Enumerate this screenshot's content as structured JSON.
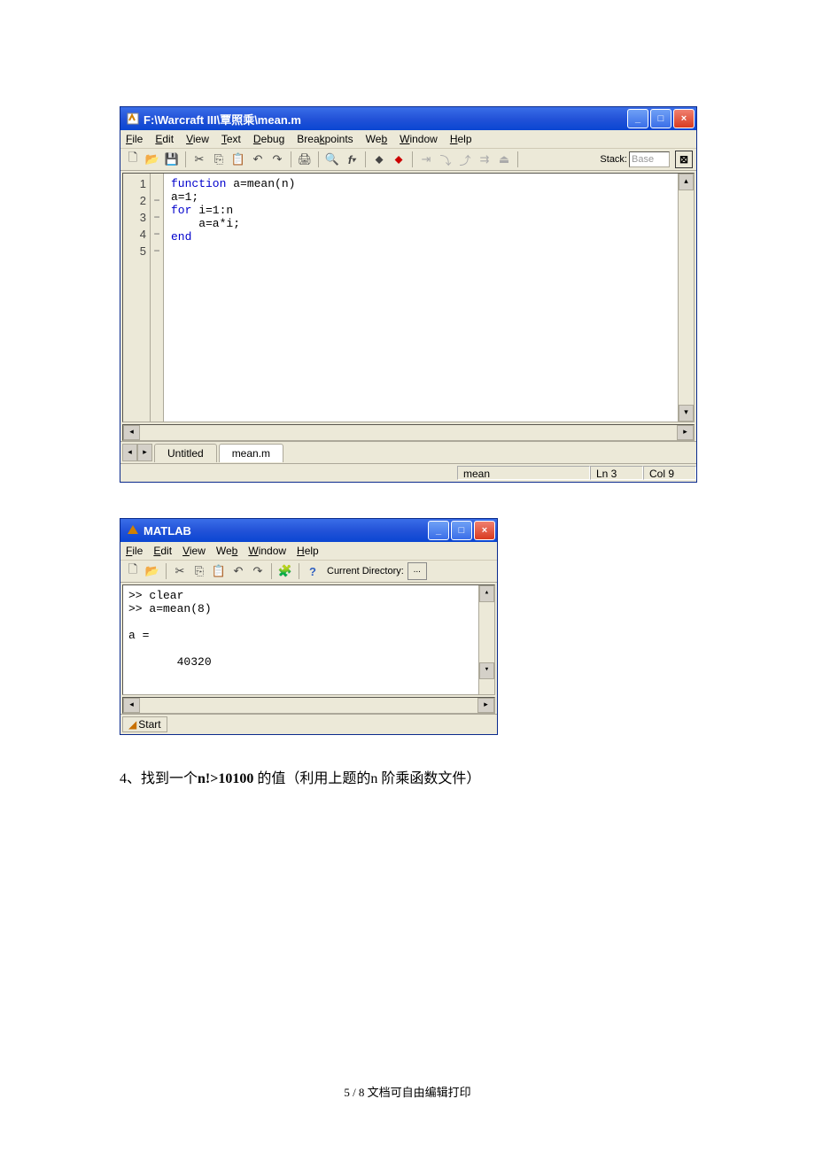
{
  "editor": {
    "title": "F:\\Warcraft III\\覃照乘\\mean.m",
    "menu": [
      "File",
      "Edit",
      "View",
      "Text",
      "Debug",
      "Breakpoints",
      "Web",
      "Window",
      "Help"
    ],
    "menu_ul": [
      "F",
      "E",
      "V",
      "T",
      "D",
      "k",
      "b",
      "W",
      "H"
    ],
    "stack_label": "Stack:",
    "stack_value": "Base",
    "lines": [
      "1",
      "2",
      "3",
      "4",
      "5"
    ],
    "fold": [
      "",
      "−",
      "−",
      "−",
      "−"
    ],
    "code": [
      {
        "indent": "",
        "kw": "function",
        "rest": " a=mean(n)"
      },
      {
        "indent": "",
        "kw": "",
        "rest": "a=1;"
      },
      {
        "indent": "",
        "kw": "for",
        "rest": " i=1:n"
      },
      {
        "indent": "    ",
        "kw": "",
        "rest": "a=a*i;"
      },
      {
        "indent": "",
        "kw": "end",
        "rest": ""
      }
    ],
    "tabs": [
      "Untitled",
      "mean.m"
    ],
    "status": {
      "func": "mean",
      "ln": "Ln 3",
      "col": "Col 9"
    }
  },
  "cmdwin": {
    "title": "MATLAB",
    "menu": [
      "File",
      "Edit",
      "View",
      "Web",
      "Window",
      "Help"
    ],
    "menu_ul": [
      "F",
      "E",
      "V",
      "b",
      "W",
      "H"
    ],
    "dir_label": "Current Directory:",
    "dir_btn": "...",
    "console_lines": [
      ">> clear",
      ">> a=mean(8)",
      "",
      "a =",
      "",
      "       40320"
    ],
    "start": "Start"
  },
  "doctext": "4、找到一个n!>10100 的值（利用上题的n 阶乘函数文件）",
  "footer": "5 / 8 文档可自由编辑打印"
}
